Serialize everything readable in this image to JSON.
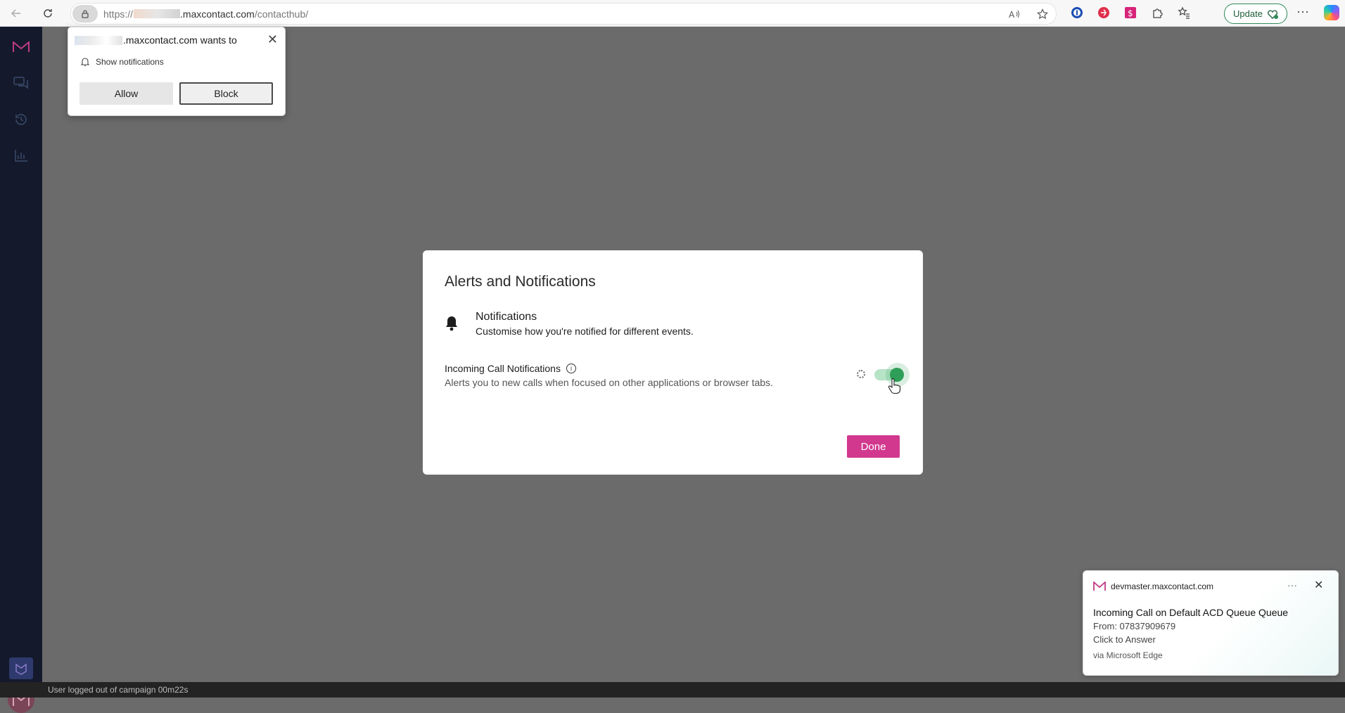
{
  "browser": {
    "url": {
      "scheme": "https://",
      "domain": ".maxcontact.com",
      "path": "/contacthub/"
    },
    "update_label": "Update",
    "icons": [
      "back-icon",
      "reload-icon",
      "lock-icon",
      "read-aloud-icon",
      "favorite-star-icon",
      "password-manager-icon",
      "extension-red-icon",
      "extension-pink-icon",
      "extensions-puzzle-icon",
      "favorites-icon",
      "more-icon",
      "copilot-icon"
    ]
  },
  "permission_popup": {
    "title_suffix": ".maxcontact.com wants to",
    "request": "Show notifications",
    "allow_label": "Allow",
    "block_label": "Block"
  },
  "modal": {
    "title": "Alerts and Notifications",
    "section_title": "Notifications",
    "section_subtitle": "Customise how you're notified for different events.",
    "setting_label": "Incoming Call Notifications",
    "setting_description": "Alerts you to new calls when focused on other applications or browser tabs.",
    "toggle_on": true,
    "done_label": "Done"
  },
  "toast": {
    "site": "devmaster.maxcontact.com",
    "title": "Incoming Call on Default ACD Queue Queue",
    "from": "From: 07837909679",
    "action": "Click to Answer",
    "via": "via Microsoft Edge"
  },
  "status_bar": {
    "text": "User logged out of campaign 00m22s"
  },
  "colors": {
    "brand_pink": "#d2388e",
    "toggle_green": "#2f9e58",
    "sidebar_bg": "#141a2c",
    "overlay_gray": "#6b6b6b"
  }
}
